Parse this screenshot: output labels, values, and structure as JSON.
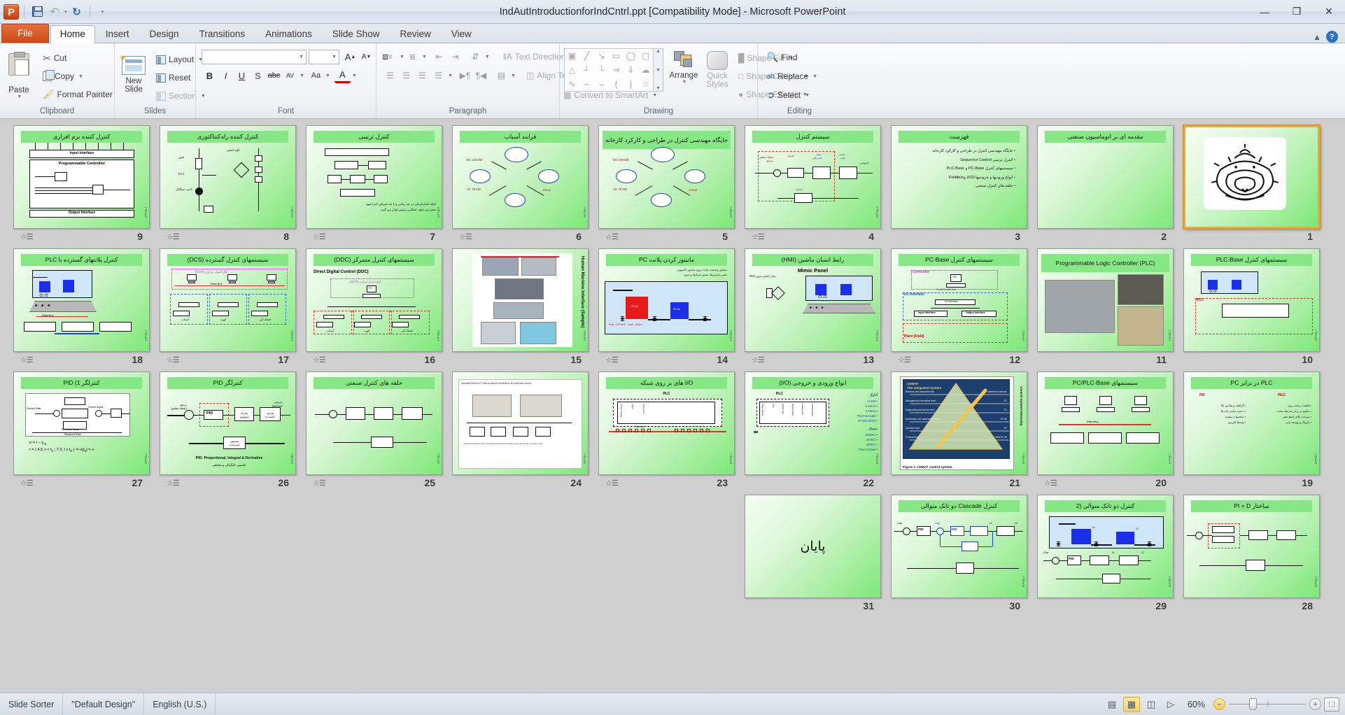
{
  "window": {
    "title": "IndAutIntroductionforIndCntrl.ppt [Compatibility Mode]  -  Microsoft PowerPoint",
    "minimize": "—",
    "restore": "❐",
    "close": "✕"
  },
  "qat": {
    "logo": "P",
    "save": "save-icon",
    "undo": "↶",
    "redo": "↻",
    "customize": "▾"
  },
  "tabs": [
    {
      "label": "File",
      "kind": "file"
    },
    {
      "label": "Home",
      "kind": "active"
    },
    {
      "label": "Insert",
      "kind": "normal"
    },
    {
      "label": "Design",
      "kind": "normal"
    },
    {
      "label": "Transitions",
      "kind": "normal"
    },
    {
      "label": "Animations",
      "kind": "normal"
    },
    {
      "label": "Slide Show",
      "kind": "normal"
    },
    {
      "label": "Review",
      "kind": "normal"
    },
    {
      "label": "View",
      "kind": "normal"
    }
  ],
  "ribbon": {
    "groups": {
      "clipboard": "Clipboard",
      "slides": "Slides",
      "font": "Font",
      "paragraph": "Paragraph",
      "drawing": "Drawing",
      "editing": "Editing"
    },
    "clipboard": {
      "paste": "Paste",
      "cut": "Cut",
      "copy": "Copy",
      "format_painter": "Format Painter"
    },
    "slides": {
      "new_slide": "New",
      "new_slide2": "Slide",
      "layout": "Layout",
      "reset": "Reset",
      "section": "Section"
    },
    "font": {
      "font_name": "",
      "font_size": "",
      "grow": "A",
      "shrink": "A",
      "clear_formatting": "clear-format-icon",
      "bold": "B",
      "italic": "I",
      "underline": "U",
      "shadow": "S",
      "strikethrough": "abc",
      "char_spacing": "AV",
      "change_case": "Aa",
      "font_color": "A"
    },
    "paragraph": {
      "bullets": "bullets-icon",
      "numbering": "numbering-icon",
      "decrease_indent": "decrease-indent-icon",
      "increase_indent": "increase-indent-icon",
      "line_spacing": "line-spacing-icon",
      "text_direction": "Text Direction",
      "align_text": "Align Text",
      "convert_smartart": "Convert to SmartArt",
      "align_left": "align-left-icon",
      "align_center": "align-center-icon",
      "align_right": "align-right-icon",
      "justify": "justify-icon",
      "ltr": "ltr-icon",
      "rtl": "rtl-icon",
      "columns": "columns-icon"
    },
    "drawing": {
      "arrange": "Arrange",
      "quick_styles": "Quick",
      "quick_styles2": "Styles",
      "shape_fill": "Shape Fill",
      "shape_outline": "Shape Outline",
      "shape_effects": "Shape Effects",
      "shapes": [
        "⊞",
        "╲",
        "↘",
        "▭",
        "◯",
        "▢",
        "△",
        "┐",
        "┘",
        "⇨",
        "⇩",
        "☁",
        "⌇",
        "⌢",
        "⌒",
        "{",
        "}",
        "☆"
      ]
    },
    "editing": {
      "find": "Find",
      "replace": "Replace",
      "select": "Select"
    }
  },
  "slides": [
    {
      "num": "9",
      "title": "کنترل کننده نرم افزاری",
      "kind": "plc-diagram",
      "transition": true
    },
    {
      "num": "8",
      "title": "کنترل کننده رله‌کنتاکتوری",
      "kind": "ladder",
      "transition": true
    },
    {
      "num": "7",
      "title": "کنترل ترتیبی",
      "kind": "seq-ctrl",
      "transition": true
    },
    {
      "num": "6",
      "title": "فرایند آسیاب",
      "kind": "process",
      "transition": true
    },
    {
      "num": "5",
      "title": "جایگاه مهندسی کنترل در طراحی و کارکرد کارخانه",
      "kind": "process",
      "transition": true
    },
    {
      "num": "4",
      "title": "سیستم کنترل",
      "kind": "block-ctrl",
      "transition": true
    },
    {
      "num": "3",
      "title": "فهرست",
      "kind": "toc",
      "transition": false,
      "bullets": [
        "جایگاه مهندسی کنترل در طراحی و کارکرد کارخانه",
        "کنترل ترتیبی Sequence Control",
        "سیستمهای کنترل PC-Base و PLC-Base",
        "انواع ورودیها و خروجیها (I/O) وFieldbus",
        "حلقه های کنترل صنعتی"
      ]
    },
    {
      "num": "2",
      "title": "مقدمه ای بر اتوماسیون صنعتی",
      "kind": "title-only",
      "transition": false
    },
    {
      "num": "1",
      "title": "",
      "kind": "calligraphy",
      "selected": true,
      "transition": false
    },
    {
      "num": "18",
      "title": "کنترل پلانتهای گسترده با PLC",
      "kind": "plant-plc",
      "transition": true
    },
    {
      "num": "17",
      "title": "سیستمهای کنترل گسترده (DCS)",
      "kind": "dcs",
      "transition": true
    },
    {
      "num": "16",
      "title": "سیستمهای کنترل متمرکز (DDC)",
      "kind": "ddc",
      "subtitle": "Direct Digital Control (DDC)",
      "transition": true
    },
    {
      "num": "15",
      "title": "",
      "kind": "hmi-photos",
      "sidelabel": "Human Machine Interface (Sample)",
      "transition": false
    },
    {
      "num": "14",
      "title": "مانیتور کردن پلانت PC",
      "kind": "monitor-pc",
      "transition": true
    },
    {
      "num": "13",
      "title": "رابط انسان ماشین (HMI)",
      "kind": "mimic",
      "subtitle": "Mimic Panel",
      "transition": true
    },
    {
      "num": "12",
      "title": "سیستمهای کنترل PC-Base",
      "kind": "pcbase",
      "transition": true
    },
    {
      "num": "11",
      "title": "Programmable Logic Controller (PLC)",
      "kind": "plc-photos",
      "transition": false
    },
    {
      "num": "10",
      "title": "سیستمهای کنترل PLC-Base",
      "kind": "plcbase",
      "transition": false
    },
    {
      "num": "27",
      "title": "کنترلگر PID (1",
      "kind": "pid1",
      "transition": true
    },
    {
      "num": "26",
      "title": "کنترلگر PID",
      "kind": "pid-loop",
      "subtitle": "PID: Proportional, Integral & Derivative",
      "transition": true
    },
    {
      "num": "25",
      "title": "حلقه های کنترل صنعتی",
      "kind": "ctrl-loop",
      "transition": true
    },
    {
      "num": "24",
      "title": "",
      "kind": "network-doc",
      "transition": false
    },
    {
      "num": "23",
      "title": "I/O های بر روی شبکه",
      "kind": "io-net",
      "transition": true
    },
    {
      "num": "22",
      "title": "انواع ورودی و خروجی (I/O)",
      "kind": "io-types",
      "transition": false,
      "analog_label": "آنالوگ",
      "analog": [
        "0-10V",
        "0-20mA",
        "4-20mA",
        "Thermocouple",
        "PT100 (RTD)"
      ],
      "digital_label": "دیجیتال",
      "digital": [
        "220VAC",
        "24VDC",
        "48VDC",
        "Free Contact"
      ]
    },
    {
      "num": "21",
      "title": "",
      "kind": "cemat",
      "caption": "Figure 1. CEMAT control system.",
      "heading": "CEMAT-\nThe Integrated System",
      "sidelabel": "Control System Hierarchy",
      "levels": [
        {
          "left": "Business and corporate level",
          "right": "Mainframe,minicom"
        },
        {
          "left": "Management information level",
          "right": "PC"
        },
        {
          "left": "Engineering and service level",
          "right": "PC"
        },
        {
          "left": "Automation and optimisation level",
          "right": "PC S5"
        },
        {
          "left": "Operator level",
          "right": "PC"
        },
        {
          "left": "Process level",
          "right": "SIMATIC S5"
        }
      ],
      "transition": false
    },
    {
      "num": "20",
      "title": "سیستمهای PC/PLC-Base",
      "kind": "pcplc",
      "transition": true
    },
    {
      "num": "19",
      "title": "PLC در برابر PC",
      "kind": "pc-vs-plc",
      "leftlabel": "PC",
      "rightlabel": "PLC",
      "transition": false
    },
    {
      "num": "31",
      "title": "",
      "kind": "end",
      "endtext": "پایان",
      "transition": false
    },
    {
      "num": "30",
      "title": "کنترل Cascade دو تانک متوالی",
      "kind": "cascade",
      "transition": false
    },
    {
      "num": "29",
      "title": "کنترل دو تانک متوالی (2",
      "kind": "twotank",
      "transition": false
    },
    {
      "num": "28",
      "title": "ساختار PI + D",
      "kind": "pid-struct",
      "transition": false
    }
  ],
  "status": {
    "view": "Slide Sorter",
    "design": "\"Default Design\"",
    "language": "English (U.S.)",
    "zoom": "60%",
    "views": [
      {
        "name": "normal-view-button",
        "glyph": "▤",
        "active": false
      },
      {
        "name": "slide-sorter-view-button",
        "glyph": "▦",
        "active": true
      },
      {
        "name": "reading-view-button",
        "glyph": "◫",
        "active": false
      },
      {
        "name": "slide-show-button",
        "glyph": "▷",
        "active": false
      }
    ],
    "zoom_out": "−",
    "zoom_in": "+",
    "fit_window": "⬚"
  }
}
